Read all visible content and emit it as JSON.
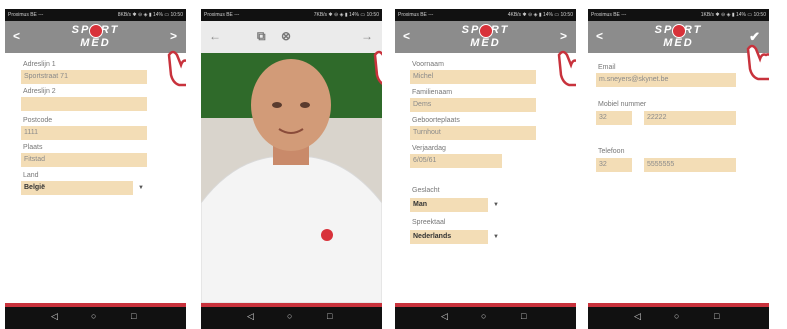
{
  "status": {
    "carrier": "Proximus BE ---",
    "icons": [
      "8KB/s ✱ ⊖ ◈ ▮ 14% ▭ 10:50",
      "7KB/s ✱ ⊖ ◈ ▮ 14% ▭ 10:50",
      "4KB/s ✱ ⊖ ◈ ▮ 14% ▭ 10:50",
      "1KB/s ✱ ⊖ ◈ ▮ 14% ▭ 10:50"
    ]
  },
  "logo": {
    "line1": "SPORT",
    "line2": "MED"
  },
  "icons": {
    "back": "chevron-left-icon",
    "forward": "chevron-right-icon",
    "confirm": "check-icon"
  },
  "colors": {
    "appbar": "#8c8c8c",
    "field": "#f3ddb6",
    "accent": "#c8323c"
  },
  "screen1": {
    "fields": [
      {
        "label": "Adreslijn 1",
        "value": "Sportstraat 71"
      },
      {
        "label": "Adreslijn 2",
        "value": ""
      },
      {
        "label": "Postcode",
        "value": "1111"
      },
      {
        "label": "Plaats",
        "value": "Fitstad"
      }
    ],
    "country": {
      "label": "Land",
      "value": "België"
    }
  },
  "screen2": {
    "toolbar": [
      "←",
      "⧉",
      "⊗",
      "→"
    ]
  },
  "screen3": {
    "fields": [
      {
        "label": "Voornaam",
        "value": "Michel"
      },
      {
        "label": "Familienaam",
        "value": "Dems"
      },
      {
        "label": "Geboorteplaats",
        "value": "Turnhout"
      },
      {
        "label": "Verjaardag",
        "value": "6/05/61"
      }
    ],
    "gender": {
      "label": "Geslacht",
      "value": "Man"
    },
    "language": {
      "label": "Spreektaal",
      "value": "Nederlands"
    }
  },
  "screen4": {
    "email": {
      "label": "Email",
      "value": "m.sneyers@skynet.be"
    },
    "mobile": {
      "label": "Mobiel nummer",
      "prefix": "32",
      "number": "22222"
    },
    "phone": {
      "label": "Telefoon",
      "prefix": "32",
      "number": "5555555"
    }
  },
  "navbar": {
    "back": "◁",
    "home": "○",
    "recents": "□"
  }
}
